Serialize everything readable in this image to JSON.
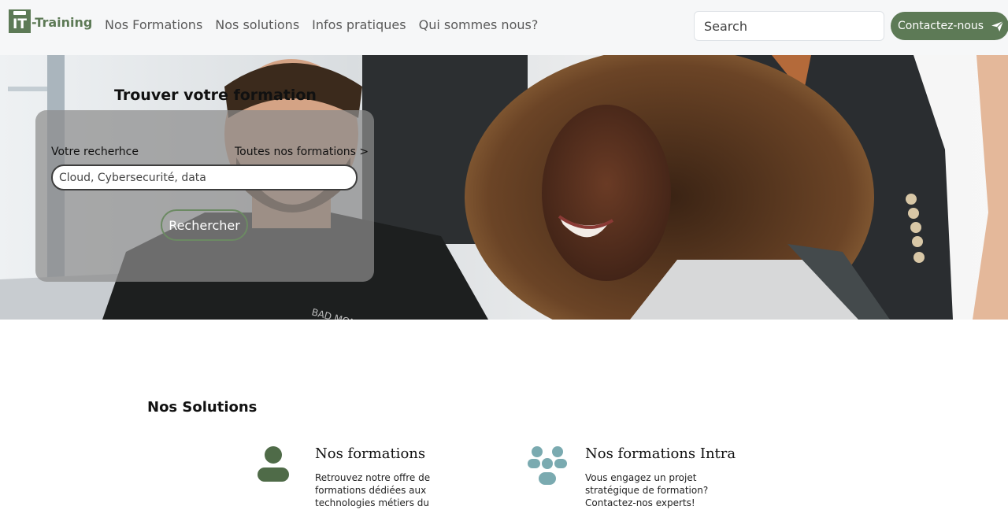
{
  "brand": {
    "mark": "IT",
    "name": "-Training",
    "color": "#5d7a56"
  },
  "nav": {
    "links": [
      "Nos Formations",
      "Nos solutions",
      "Infos pratiques",
      "Qui sommes nous?"
    ],
    "search_placeholder": "Search",
    "contact_label": "Contactez-nous",
    "contact_icon": "send-icon"
  },
  "hero": {
    "title": "Trouver votre formation",
    "search_label": "Votre recherhce",
    "all_link": "Toutes nos formations >",
    "input_placeholder": "Cloud, Cybersecurité, data",
    "button_label": "Rechercher"
  },
  "solutions": {
    "title": "Nos Solutions",
    "items": [
      {
        "name": "Nos formations",
        "icon": "person-icon",
        "color": "#4f6b48",
        "desc": "Retrouvez notre offre de formations dédiées aux technologies métiers du"
      },
      {
        "name": "Nos formations Intra",
        "icon": "group-icon",
        "color": "#7aaab0",
        "desc": "Vous engagez un projet stratégique de formation? Contactez-nos experts!"
      }
    ]
  }
}
